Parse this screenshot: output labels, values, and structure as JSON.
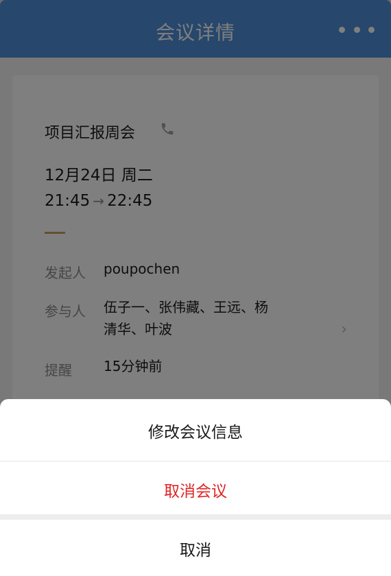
{
  "header": {
    "title": "会议详情"
  },
  "meeting": {
    "title": "项目汇报周会",
    "date": "12月24日 周二",
    "start_time": "21:45",
    "end_time": "22:45",
    "organizer_label": "发起人",
    "organizer": "poupochen",
    "participants_label": "参与人",
    "participants_line1": "伍子一、张伟藏、王远、杨",
    "participants_line2": "清华、叶波",
    "reminder_label": "提醒",
    "reminder": "15分钟前"
  },
  "action_sheet": {
    "edit_label": "修改会议信息",
    "cancel_meeting_label": "取消会议",
    "cancel_label": "取消",
    "danger_color": "#e02424"
  }
}
